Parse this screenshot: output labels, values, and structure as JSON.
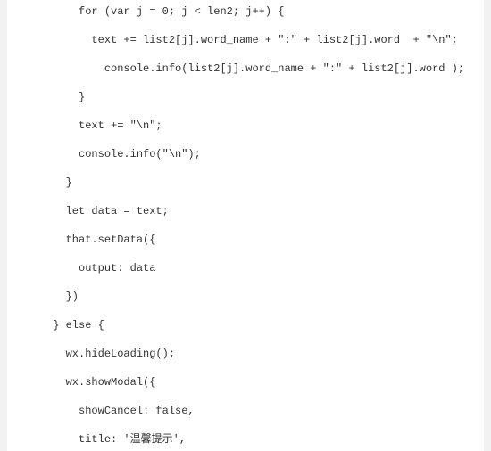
{
  "code": {
    "lines": [
      "          for (var j = 0; j < len2; j++) {",
      "",
      "            text += list2[j].word_name + \":\" + list2[j].word  + \"\\n\";",
      "",
      "              console.info(list2[j].word_name + \":\" + list2[j].word );",
      "",
      "          }",
      "",
      "          text += \"\\n\";",
      "",
      "          console.info(\"\\n\");",
      "",
      "        }",
      "",
      "        let data = text;",
      "",
      "        that.setData({",
      "",
      "          output: data",
      "",
      "        })",
      "",
      "      } else {",
      "",
      "        wx.hideLoading();",
      "",
      "        wx.showModal({",
      "",
      "          showCancel: false,",
      "",
      "          title: '温馨提示',"
    ]
  }
}
